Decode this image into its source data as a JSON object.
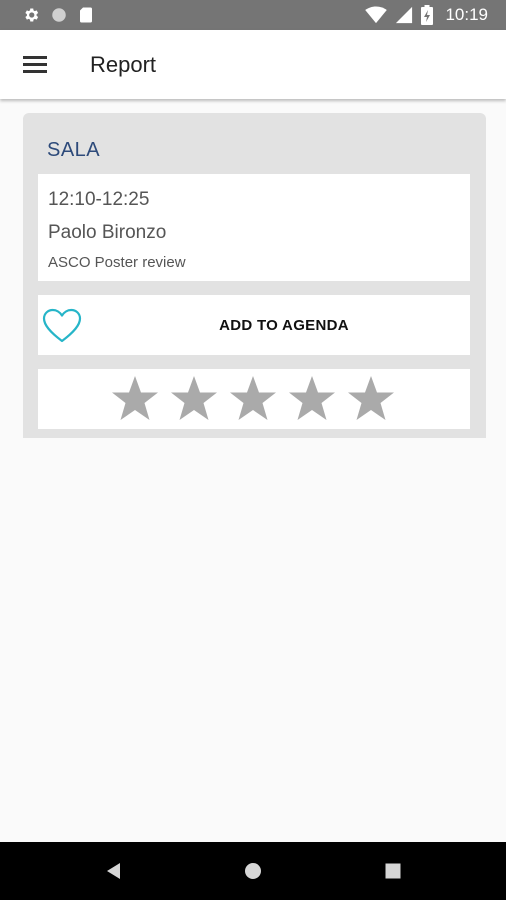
{
  "status_bar": {
    "time": "10:19",
    "icons": [
      "settings-icon",
      "circle-icon",
      "sd-card-icon",
      "wifi-icon",
      "signal-icon",
      "battery-icon"
    ]
  },
  "app_bar": {
    "title": "Report",
    "menu_icon": "hamburger-menu-icon"
  },
  "session": {
    "room": "SALA",
    "time": "12:10-12:25",
    "speaker": "Paolo Bironzo",
    "title": "ASCO Poster review"
  },
  "agenda": {
    "label": "ADD TO AGENDA",
    "icon": "heart-outline-icon",
    "icon_color": "#26b5c8"
  },
  "rating": {
    "max": 5,
    "value": 0,
    "star_color": "#aaaaaa"
  },
  "nav_bar": {
    "buttons": [
      "back-icon",
      "home-icon",
      "recents-icon"
    ]
  }
}
